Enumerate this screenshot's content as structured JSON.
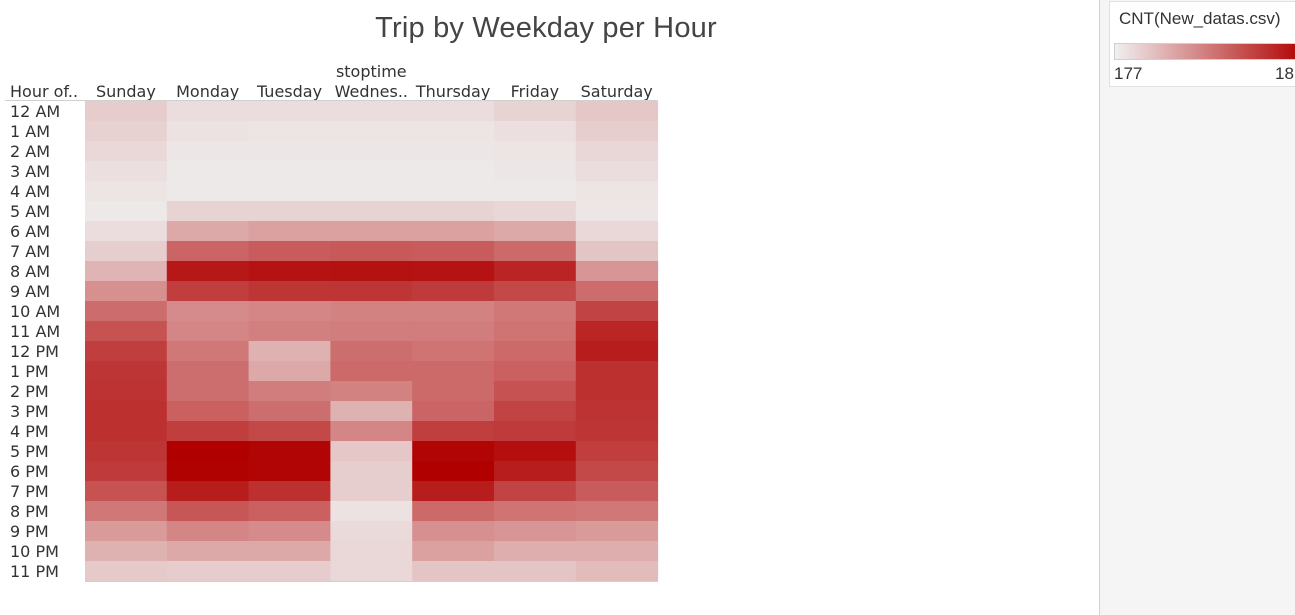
{
  "chart_data": {
    "type": "heatmap",
    "title": "Trip by Weekday per Hour",
    "column_header": "stoptime",
    "row_header": "Hour of..",
    "columns": [
      "Sunday",
      "Monday",
      "Tuesday",
      "Wednes..",
      "Thursday",
      "Friday",
      "Saturday"
    ],
    "rows": [
      "12 AM",
      "1 AM",
      "2 AM",
      "3 AM",
      "4 AM",
      "5 AM",
      "6 AM",
      "7 AM",
      "8 AM",
      "9 AM",
      "10 AM",
      "11 AM",
      "12 PM",
      "1 PM",
      "2 PM",
      "3 PM",
      "4 PM",
      "5 PM",
      "6 PM",
      "7 PM",
      "8 PM",
      "9 PM",
      "10 PM",
      "11 PM"
    ],
    "intensity_scale": [
      0,
      1
    ],
    "intensity": [
      [
        0.15,
        0.08,
        0.08,
        0.08,
        0.08,
        0.12,
        0.17
      ],
      [
        0.13,
        0.06,
        0.05,
        0.05,
        0.05,
        0.07,
        0.14
      ],
      [
        0.1,
        0.04,
        0.04,
        0.04,
        0.04,
        0.05,
        0.11
      ],
      [
        0.07,
        0.03,
        0.03,
        0.03,
        0.03,
        0.04,
        0.08
      ],
      [
        0.05,
        0.03,
        0.03,
        0.03,
        0.03,
        0.03,
        0.05
      ],
      [
        0.03,
        0.12,
        0.12,
        0.12,
        0.12,
        0.11,
        0.04
      ],
      [
        0.08,
        0.3,
        0.33,
        0.33,
        0.33,
        0.3,
        0.1
      ],
      [
        0.14,
        0.58,
        0.62,
        0.63,
        0.62,
        0.56,
        0.18
      ],
      [
        0.25,
        0.9,
        0.92,
        0.93,
        0.92,
        0.85,
        0.38
      ],
      [
        0.4,
        0.74,
        0.78,
        0.78,
        0.76,
        0.7,
        0.55
      ],
      [
        0.55,
        0.42,
        0.44,
        0.46,
        0.46,
        0.5,
        0.72
      ],
      [
        0.66,
        0.44,
        0.47,
        0.48,
        0.48,
        0.52,
        0.84
      ],
      [
        0.74,
        0.5,
        0.26,
        0.54,
        0.52,
        0.56,
        0.88
      ],
      [
        0.78,
        0.54,
        0.3,
        0.56,
        0.56,
        0.6,
        0.8
      ],
      [
        0.79,
        0.54,
        0.48,
        0.46,
        0.56,
        0.66,
        0.8
      ],
      [
        0.8,
        0.6,
        0.54,
        0.26,
        0.58,
        0.72,
        0.79
      ],
      [
        0.8,
        0.74,
        0.7,
        0.44,
        0.74,
        0.76,
        0.78
      ],
      [
        0.78,
        1.0,
        0.98,
        0.17,
        0.98,
        0.94,
        0.74
      ],
      [
        0.76,
        0.99,
        0.98,
        0.14,
        1.0,
        0.88,
        0.7
      ],
      [
        0.66,
        0.88,
        0.8,
        0.14,
        0.88,
        0.72,
        0.62
      ],
      [
        0.5,
        0.64,
        0.6,
        0.06,
        0.56,
        0.52,
        0.5
      ],
      [
        0.36,
        0.44,
        0.42,
        0.09,
        0.4,
        0.38,
        0.36
      ],
      [
        0.26,
        0.3,
        0.3,
        0.1,
        0.33,
        0.28,
        0.28
      ],
      [
        0.16,
        0.15,
        0.15,
        0.1,
        0.18,
        0.18,
        0.22
      ]
    ]
  },
  "legend": {
    "title": "CNT(New_datas.csv)",
    "min_label": "177",
    "max_label": "18",
    "low_color": "#f0f0f0",
    "high_color": "#b00000"
  }
}
